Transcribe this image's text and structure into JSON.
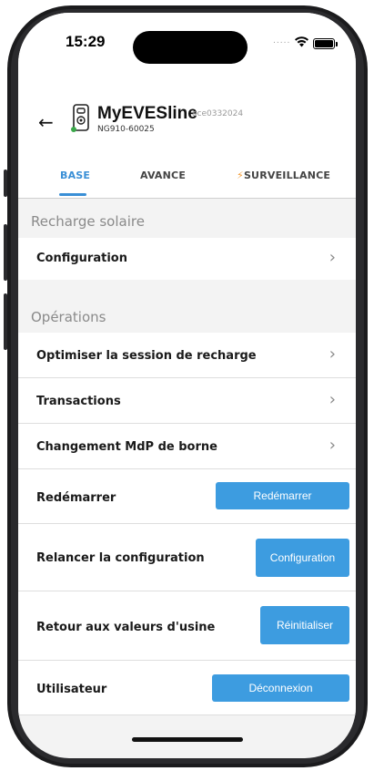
{
  "status_bar": {
    "time": "15:29",
    "signal_dots": "....."
  },
  "header": {
    "device_name": "MyEVESline",
    "device_id": "ace0332024",
    "serial": "NG910-60025"
  },
  "tabs": [
    {
      "label": "BASE"
    },
    {
      "label": "AVANCE"
    },
    {
      "label": "SURVEILLANCE"
    }
  ],
  "sections": {
    "solar": {
      "title": "Recharge solaire",
      "rows": [
        {
          "label": "Configuration"
        }
      ]
    },
    "ops": {
      "title": "Opérations",
      "rows": [
        {
          "label": "Optimiser la session de recharge"
        },
        {
          "label": "Transactions"
        },
        {
          "label": "Changement MdP de borne"
        },
        {
          "label": "Redémarrer",
          "button": "Redémarrer"
        },
        {
          "label": "Relancer la configuration",
          "button": "Configuration"
        },
        {
          "label": "Retour aux valeurs d'usine",
          "button": "Réinitialiser"
        },
        {
          "label": "Utilisateur",
          "button": "Déconnexion"
        }
      ]
    }
  },
  "icons": {
    "back": "arrow-left-icon",
    "charger": "ev-charger-icon",
    "chevron": "chevron-right-icon",
    "bolt": "lightning-icon"
  },
  "colors": {
    "accent": "#3a8fd6",
    "button": "#3d9ce0",
    "bolt": "#f29c38",
    "online_dot": "#3aa84a"
  }
}
